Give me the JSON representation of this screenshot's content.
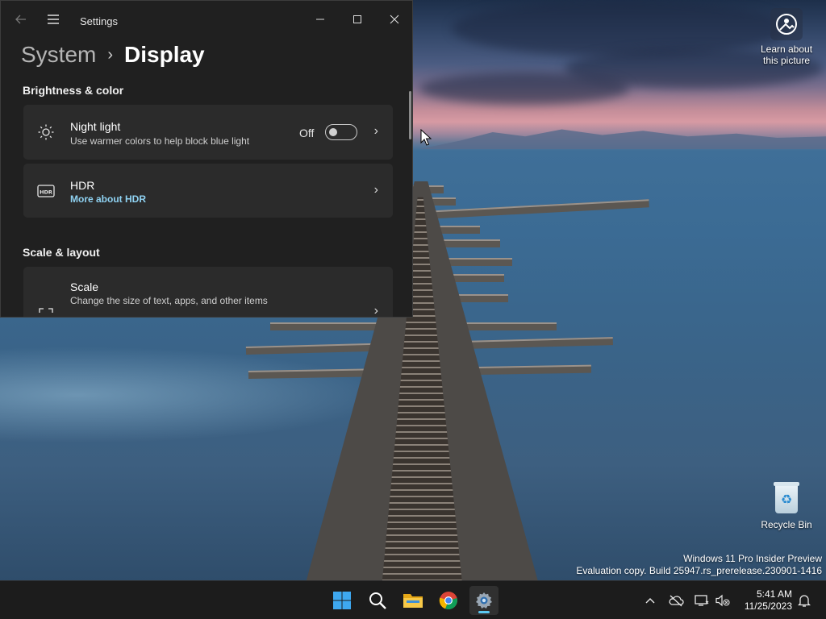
{
  "desktop": {
    "learn_label": "Learn about this picture",
    "recycle_label": "Recycle Bin",
    "watermark_line1": "Windows 11 Pro Insider Preview",
    "watermark_line2": "Evaluation copy. Build 25947.rs_prerelease.230901-1416"
  },
  "window": {
    "app_title": "Settings",
    "breadcrumb_parent": "System",
    "breadcrumb_separator": "›",
    "breadcrumb_current": "Display",
    "sections": {
      "brightness_title": "Brightness & color",
      "scale_layout_title": "Scale & layout"
    },
    "night_light": {
      "title": "Night light",
      "subtitle": "Use warmer colors to help block blue light",
      "toggle_state": "Off"
    },
    "hdr": {
      "title": "HDR",
      "link": "More about HDR"
    },
    "scale": {
      "title": "Scale",
      "subtitle": "Change the size of text, apps, and other items"
    }
  },
  "taskbar": {
    "apps": [
      {
        "name": "Start",
        "icon": "windows-logo-icon"
      },
      {
        "name": "Search",
        "icon": "search-icon"
      },
      {
        "name": "File Explorer",
        "icon": "folder-icon"
      },
      {
        "name": "Google Chrome",
        "icon": "chrome-icon"
      },
      {
        "name": "Settings",
        "icon": "gear-icon",
        "active": true
      }
    ],
    "time": "5:41 AM",
    "date": "11/25/2023"
  },
  "colors": {
    "window_bg": "#202020",
    "card_bg": "#2b2b2b",
    "accent_link": "#8fd2f2",
    "taskbar_bg": "#1c1c1c",
    "active_indicator": "#5cc8f2"
  }
}
